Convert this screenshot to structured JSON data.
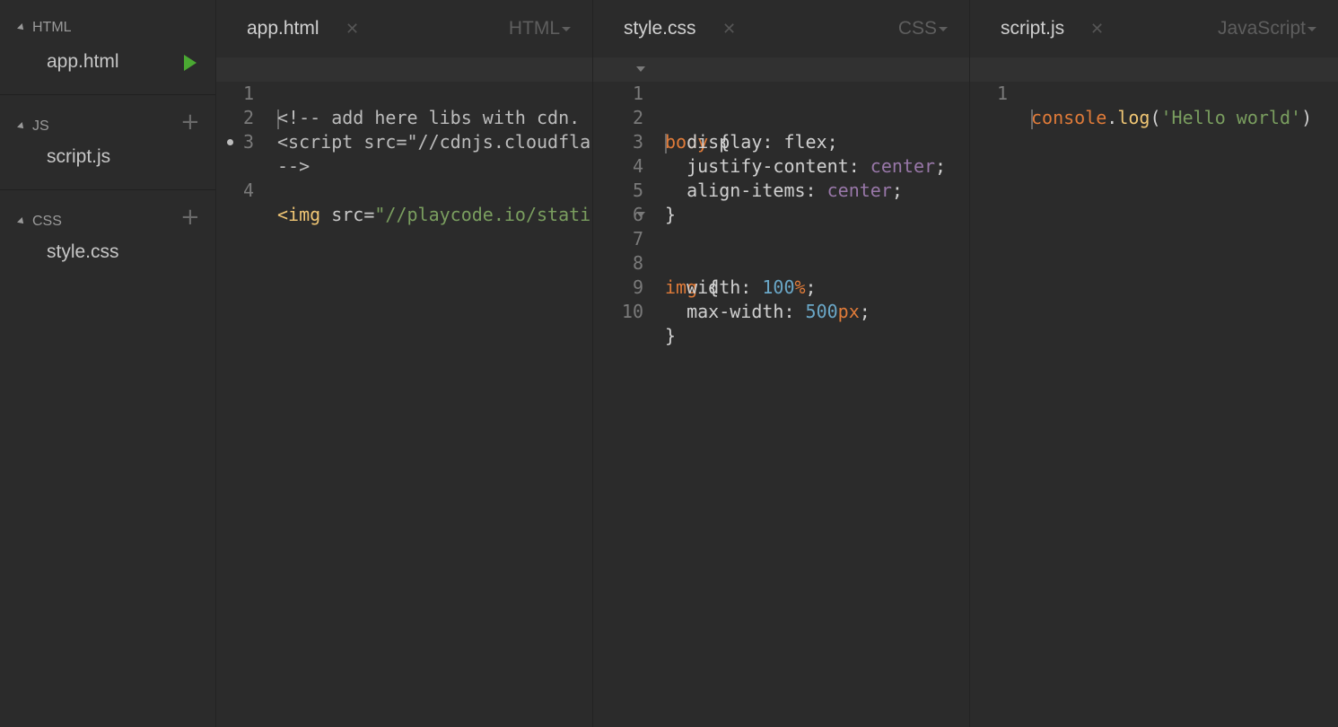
{
  "sidebar": {
    "sections": [
      {
        "title": "HTML",
        "file": "app.html"
      },
      {
        "title": "JS",
        "file": "script.js"
      },
      {
        "title": "CSS",
        "file": "style.css"
      }
    ]
  },
  "editors": [
    {
      "tab": "app.html",
      "language": "HTML",
      "lines": [
        {
          "n": "1",
          "text": "<!-- add here libs with cdn."
        },
        {
          "n": "2",
          "text": "<script src=\"//cdnjs.cloudfla"
        },
        {
          "n": "3",
          "text": "-->"
        },
        {
          "n": "4",
          "tag": "<img",
          "attr": " src=",
          "str": "\"//playcode.io/stati"
        }
      ]
    },
    {
      "tab": "style.css",
      "language": "CSS",
      "lines": [
        {
          "n": "1"
        },
        {
          "n": "2"
        },
        {
          "n": "3"
        },
        {
          "n": "4"
        },
        {
          "n": "5"
        },
        {
          "n": "6"
        },
        {
          "n": "7"
        },
        {
          "n": "8"
        },
        {
          "n": "9"
        },
        {
          "n": "10"
        }
      ],
      "code": {
        "l1_sel": "body",
        "l1_brace": " {",
        "l2_prop": "  display: ",
        "l2_val": "flex;",
        "l3_prop": "  justify-content: ",
        "l3_val": "center",
        "l3_end": ";",
        "l4_prop": "  align-items: ",
        "l4_val": "center",
        "l4_end": ";",
        "l5": "}",
        "l7_sel": "img",
        "l7_brace": " {",
        "l8_prop": "  width: ",
        "l8_num": "100",
        "l8_unit": "%",
        "l8_end": ";",
        "l9_prop": "  max-width: ",
        "l9_num": "500",
        "l9_unit": "px",
        "l9_end": ";",
        "l10": "}"
      }
    },
    {
      "tab": "script.js",
      "language": "JavaScript",
      "lines": [
        {
          "n": "1"
        }
      ],
      "code": {
        "obj": "console",
        "dot": ".",
        "fn": "log",
        "open": "(",
        "str": "'Hello world'",
        "close": ")"
      }
    }
  ]
}
